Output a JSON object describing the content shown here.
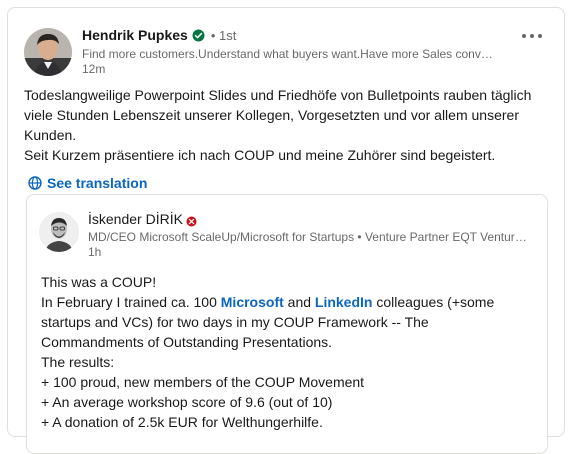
{
  "post": {
    "author": {
      "name": "Hendrik Pupkes",
      "degree": "• 1st",
      "headline": "Find more customers.Understand what buyers want.Have more Sales conversations",
      "timestamp": "12m"
    },
    "text_lines": [
      "Todeslangweilige Powerpoint Slides und Friedhöfe von Bulletpoints rauben täglich viele Stunden Lebenszeit unserer Kollegen, Vorgesetzten und vor allem unserer Kunden.",
      "Seit Kurzem präsentiere ich nach COUP und meine Zuhörer sind begeistert."
    ],
    "see_translation_label": "See translation"
  },
  "reshare": {
    "author": {
      "name": "İskender DİRİK",
      "headline": "MD/CEO Microsoft ScaleUp/Microsoft for Startups • Venture Partner EQT Ventures • Business Angel",
      "timestamp": "1h"
    },
    "line1": "This was a COUP!",
    "line2_a": "In February I trained ca. 100 ",
    "mention1": "Microsoft",
    "line2_b": " and ",
    "mention2": "LinkedIn",
    "line2_c": " colleagues (+some startups and VCs) for two days in my COUP Framework -- The Commandments of Outstanding Presentations.",
    "line3": "The results:",
    "line4": "+ 100 proud, new members of the COUP Movement",
    "line5": "+ An average workshop score of 9.6 (out of 10)",
    "line6": "+ A donation of 2.5k EUR for Welthungerhilfe."
  },
  "colors": {
    "link": "#0a66c2",
    "verified": "#057642",
    "badge": "#cc1016"
  },
  "icons": {
    "verified": "verified-check-icon",
    "more": "more-horizontal-icon",
    "globe": "globe-icon",
    "badge": "status-badge-icon"
  }
}
